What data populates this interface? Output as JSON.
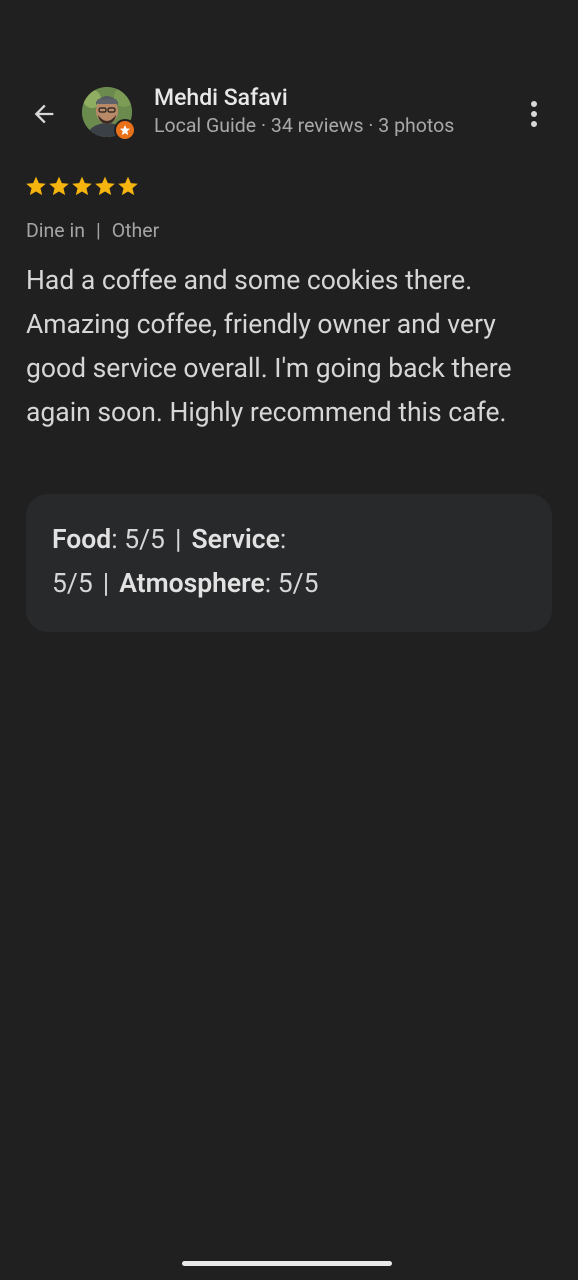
{
  "header": {
    "user_name": "Mehdi Safavi",
    "user_meta": "Local Guide · 34 reviews · 3 photos"
  },
  "review": {
    "rating": 5,
    "rating_max": 5,
    "tags": [
      "Dine in",
      "Other"
    ],
    "text": "Had a coffee and some cookies there. Amazing coffee, friendly owner and very good service overall. I'm going back there again soon. Highly recommend this cafe."
  },
  "ratings": {
    "food_label": "Food",
    "food_value": "5/5",
    "service_label": "Service",
    "service_value": "5/5",
    "atmosphere_label": "Atmosphere",
    "atmosphere_value": "5/5"
  },
  "icons": {
    "back": "arrow-left-icon",
    "more": "more-vert-icon",
    "star": "star-icon",
    "guide": "local-guide-badge-icon"
  },
  "colors": {
    "background": "#202020",
    "star": "#f6b40e",
    "guide_badge": "#e8711a",
    "card": "#28292b"
  }
}
